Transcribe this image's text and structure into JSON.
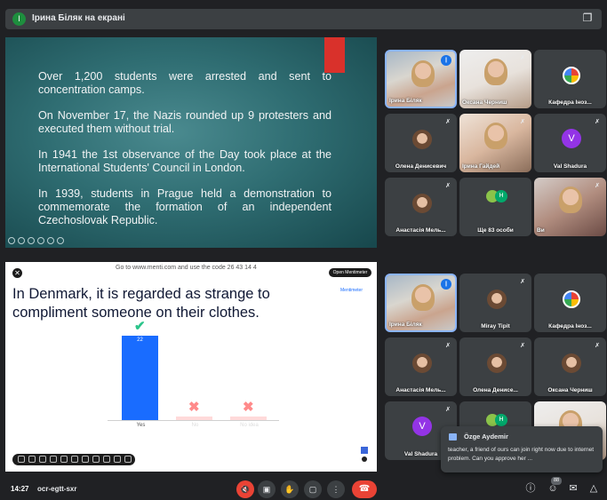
{
  "banner": {
    "avatar_letter": "І",
    "text": "Ірина Біляк на екрані",
    "minimize_icon": "minimize-icon"
  },
  "slide": {
    "paragraphs": [
      "Over 1,200 students were arrested and sent to concentration camps.",
      "On November 17, the Nazis rounded up 9 protesters and executed them without trial.",
      "In 1941 the 1st observance of the Day took place at the International Students' Council in London.",
      "In 1939, students in Prague held a demonstration to commemorate the formation of an independent Czechoslovak Republic."
    ],
    "accent_color": "#d9312b"
  },
  "menti": {
    "goto_text": "Go to www.menti.com and use the code 26 43 14 4",
    "open_label": "Open Mentimeter",
    "logo": "Mentimeter",
    "question": "In Denmark, it is regarded as strange to compliment someone on their clothes.",
    "close_icon": "close-icon"
  },
  "chart_data": {
    "type": "bar",
    "categories": [
      "Yes",
      "No",
      "No idea"
    ],
    "values": [
      22,
      0,
      0
    ],
    "data_labels": [
      "22",
      "",
      ""
    ],
    "marks": [
      "check",
      "cross",
      "cross"
    ],
    "colors": [
      "#196cff",
      "#ffdada",
      "#ffdada"
    ],
    "ylim": [
      0,
      22
    ]
  },
  "tiles": [
    {
      "name": "Ірина Біляк",
      "kind": "camera",
      "speaking": true
    },
    {
      "name": "Оксана Черниш",
      "kind": "camera",
      "muted": true
    },
    {
      "name": "Кафедра Іноз...",
      "kind": "flag",
      "muted": false
    },
    {
      "name": "Олена Денисевич",
      "kind": "photo",
      "muted": true
    },
    {
      "name": "Ірина Гайдей",
      "kind": "camera",
      "muted": true
    },
    {
      "name": "Val Shadura",
      "kind": "letter",
      "letter": "V",
      "muted": true
    },
    {
      "name": "Анастасія Мель...",
      "kind": "photo",
      "muted": true
    },
    {
      "name": "Ще 83 особи",
      "kind": "group",
      "group_letter": "H"
    },
    {
      "name": "Ви",
      "kind": "camera",
      "muted": true
    }
  ],
  "tiles2": [
    {
      "name": "Ірина Біляк",
      "kind": "camera",
      "speaking": true
    },
    {
      "name": "Miray Tipit",
      "kind": "photo",
      "muted": true
    },
    {
      "name": "Кафедра Іноз...",
      "kind": "flag"
    },
    {
      "name": "Анастасія Мель...",
      "kind": "photo",
      "muted": true
    },
    {
      "name": "Олена Денисе...",
      "kind": "photo",
      "muted": true
    },
    {
      "name": "Оксана Черниш",
      "kind": "photo",
      "muted": true
    },
    {
      "name": "Val Shadura",
      "kind": "letter",
      "muted": true
    },
    {
      "name": "",
      "kind": "group",
      "group_letter": "H"
    },
    {
      "name": "",
      "kind": "camera"
    }
  ],
  "chat": {
    "sender": "Özge Aydemir",
    "message": "teacher, a friend of ours can join right now due to internet problem. Can you approve her ..."
  },
  "bottom": {
    "time": "14:27",
    "meeting_code": "ocr-egtt-sxr",
    "participant_count": "88",
    "buttons": [
      "mic-off-icon",
      "camera-icon",
      "raise-hand-icon",
      "present-icon",
      "more-icon",
      "hang-up-icon"
    ],
    "right_icons": [
      "info-icon",
      "people-icon",
      "chat-icon",
      "activities-icon"
    ]
  }
}
